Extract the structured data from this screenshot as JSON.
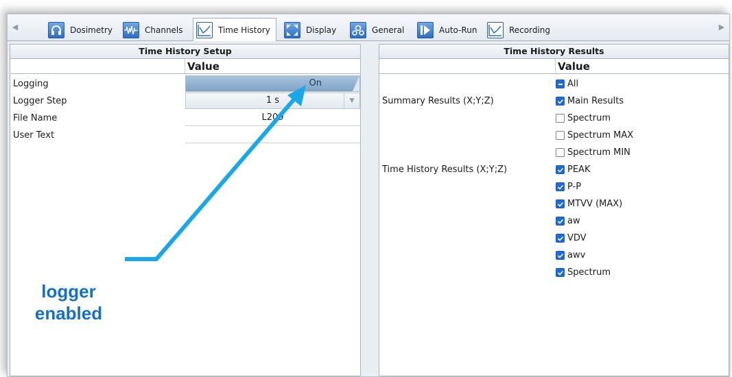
{
  "tabs": [
    {
      "label": "Dosimetry",
      "icon": "headphones-icon"
    },
    {
      "label": "Channels",
      "icon": "waveform-icon"
    },
    {
      "label": "Time History",
      "icon": "line-chart-icon",
      "active": true
    },
    {
      "label": "Display",
      "icon": "expand-icon"
    },
    {
      "label": "General",
      "icon": "gears-icon"
    },
    {
      "label": "Auto-Run",
      "icon": "play-bar-icon"
    },
    {
      "label": "Recording",
      "icon": "line-chart-icon"
    }
  ],
  "left_panel": {
    "title": "Time History Setup",
    "value_header": "Value",
    "rows": [
      {
        "label": "Logging",
        "value": "On",
        "kind": "toggle",
        "on": true
      },
      {
        "label": "Logger Step",
        "value": "1 s",
        "kind": "dropdown"
      },
      {
        "label": "File Name",
        "value": "L209",
        "kind": "text"
      },
      {
        "label": "User Text",
        "value": "",
        "kind": "text"
      }
    ]
  },
  "right_panel": {
    "title": "Time History Results",
    "value_header": "Value",
    "groups": [
      {
        "label": "Summary Results (X;Y;Z)"
      },
      {
        "label": "Time History Results  (X;Y;Z)"
      }
    ],
    "items": [
      {
        "label": "All",
        "state": "partial"
      },
      {
        "label": "Main Results",
        "state": "checked"
      },
      {
        "label": "Spectrum",
        "state": "unchecked"
      },
      {
        "label": "Spectrum MAX",
        "state": "unchecked"
      },
      {
        "label": "Spectrum MIN",
        "state": "unchecked"
      },
      {
        "label": "PEAK",
        "state": "checked"
      },
      {
        "label": "P-P",
        "state": "checked"
      },
      {
        "label": "MTVV (MAX)",
        "state": "checked"
      },
      {
        "label": "aw",
        "state": "checked"
      },
      {
        "label": "VDV",
        "state": "checked"
      },
      {
        "label": "awv",
        "state": "checked"
      },
      {
        "label": "Spectrum",
        "state": "checked"
      }
    ]
  },
  "annotation": {
    "line1": "logger",
    "line2": "enabled",
    "color": "#1570c0",
    "arrow_color": "#1aa7e8"
  },
  "colors": {
    "accent": "#1e6ad6",
    "toggle_fill": "#7fa3c7"
  }
}
